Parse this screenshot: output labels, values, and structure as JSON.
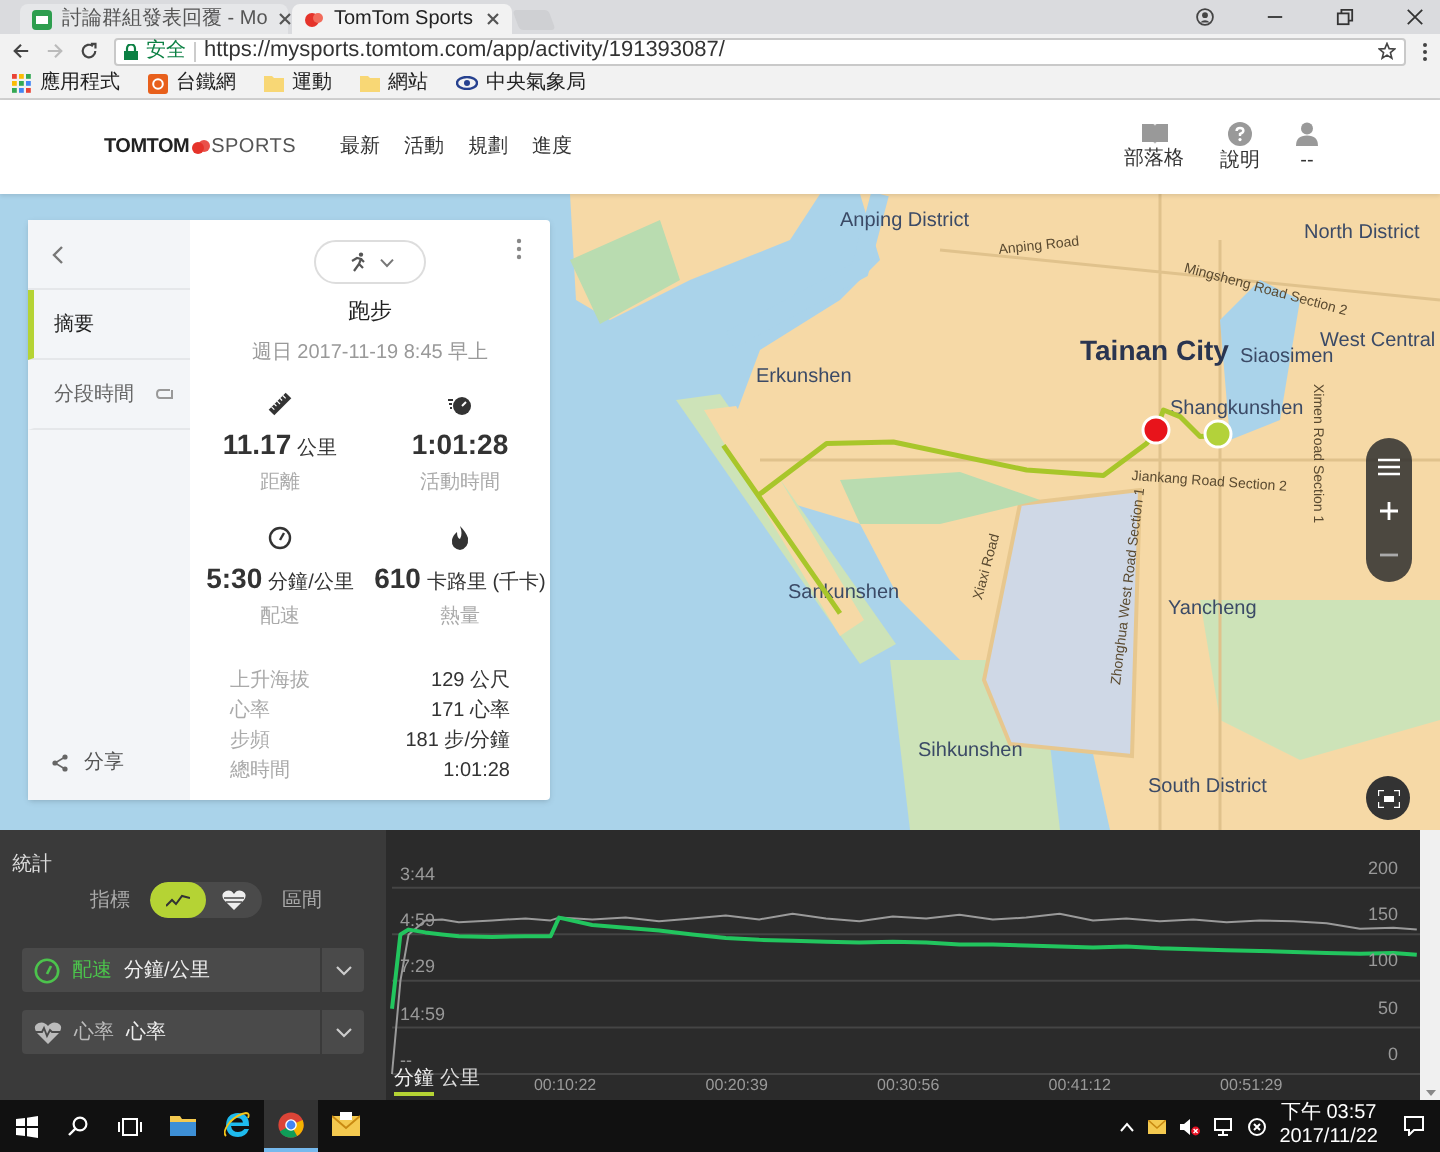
{
  "browser": {
    "tabs": [
      {
        "kind": "chat",
        "label": "討論群組發表回覆 - Mo",
        "selected": false
      },
      {
        "kind": "tomtom",
        "label": "TomTom Sports",
        "selected": true
      }
    ],
    "security": "安全",
    "url": "https://mysports.tomtom.com/app/activity/191393087/",
    "bookmarks": [
      {
        "kind": "apps",
        "label": "應用程式"
      },
      {
        "kind": "site",
        "label": "台鐵網"
      },
      {
        "kind": "folder",
        "label": "運動"
      },
      {
        "kind": "folder",
        "label": "網站"
      },
      {
        "kind": "eye",
        "label": "中央氣象局"
      }
    ]
  },
  "header": {
    "logo_main": "TOMTOM",
    "logo_sub": "SPORTS",
    "nav": [
      "最新",
      "活動",
      "規劃",
      "進度"
    ],
    "actions": [
      {
        "kind": "book",
        "label": "部落格"
      },
      {
        "kind": "help",
        "label": "說明"
      },
      {
        "kind": "user",
        "label": "--"
      }
    ]
  },
  "sidebar": {
    "items": [
      {
        "label": "摘要",
        "selected": true,
        "kind": "plain"
      },
      {
        "label": "分段時間",
        "selected": false,
        "kind": "laps"
      }
    ],
    "share": "分享"
  },
  "activity": {
    "title": "跑步",
    "date": "週日 2017-11-19 8:45 早上",
    "stats": [
      {
        "kind": "ruler",
        "value": "11.17",
        "unit": "公里",
        "label": "距離"
      },
      {
        "kind": "stopwatch",
        "value": "1:01:28",
        "label": "活動時間"
      },
      {
        "kind": "gauge",
        "value": "5:30",
        "unit": "分鐘/公里",
        "label": "配速"
      },
      {
        "kind": "flame",
        "value": "610",
        "unit": "卡路里 (千卡)",
        "label": "熱量"
      }
    ],
    "details": [
      {
        "label": "上升海拔",
        "value": "129 公尺"
      },
      {
        "label": "心率",
        "value": "171 心率"
      },
      {
        "label": "步頻",
        "value": "181 步/分鐘"
      },
      {
        "label": "總時間",
        "value": "1:01:28"
      }
    ]
  },
  "map": {
    "labels": [
      {
        "kind": "district",
        "text": "Anping District"
      },
      {
        "kind": "city",
        "text": "Tainan City"
      },
      {
        "kind": "district",
        "text": "Erkunshen"
      },
      {
        "kind": "district",
        "text": "Siaosimen"
      },
      {
        "kind": "district",
        "text": "Shangkunshen"
      },
      {
        "kind": "district",
        "text": "Sankunshen"
      },
      {
        "kind": "district",
        "text": "Yancheng"
      },
      {
        "kind": "district",
        "text": "Sihkunshen"
      },
      {
        "kind": "district",
        "text": "South District"
      },
      {
        "kind": "district",
        "text": "North District"
      },
      {
        "kind": "district",
        "text": "West Central"
      },
      {
        "kind": "road",
        "text": "Anping Road"
      },
      {
        "kind": "road",
        "text": "Jiankang Road Section 2"
      },
      {
        "kind": "road",
        "text": "Zhonghua West Road Section 1"
      },
      {
        "kind": "road",
        "text": "Mingsheng Road Section 2"
      },
      {
        "kind": "road",
        "text": "Ximen Road Section 1"
      },
      {
        "kind": "road",
        "text": "Xiaxi Road"
      }
    ]
  },
  "stats_panel": {
    "title": "統計",
    "toggle_left": "指標",
    "toggle_right": "區間",
    "views": [
      {
        "kind": "line",
        "selected": true
      },
      {
        "kind": "heart",
        "selected": false
      }
    ],
    "metrics": [
      {
        "kind": "pace",
        "name": "配速",
        "unit": "分鐘/公里",
        "active": true
      },
      {
        "kind": "heart",
        "name": "心率",
        "unit": "心率",
        "active": false
      }
    ],
    "units": [
      {
        "label": "分鐘",
        "selected": true
      },
      {
        "label": "公里",
        "selected": false
      }
    ],
    "pace_axis": [
      "3:44",
      "4:59",
      "7:29",
      "14:59",
      "--"
    ],
    "chart_data": {
      "type": "line",
      "x": [
        0,
        0.5,
        1,
        2,
        3,
        4,
        6,
        8,
        9.5,
        10,
        12,
        14,
        16,
        18,
        20,
        22,
        24,
        26,
        28,
        30,
        32,
        34,
        36,
        38,
        40,
        42,
        44,
        46,
        48,
        50,
        52,
        54,
        56,
        58,
        60,
        61.4
      ],
      "series": [
        {
          "color": "#9a9a9a",
          "values": [
            0,
            100,
            150,
            165,
            166,
            163,
            165,
            167,
            165,
            168,
            166,
            168,
            164,
            167,
            170,
            166,
            172,
            167,
            164,
            169,
            167,
            171,
            166,
            168,
            172,
            165,
            167,
            164,
            166,
            163,
            165,
            164,
            162,
            156,
            157,
            155
          ]
        },
        {
          "color": "#22c55e",
          "values": [
            70,
            150,
            155,
            152,
            150,
            148,
            147,
            148,
            148,
            168,
            160,
            157,
            154,
            150,
            146,
            144,
            143,
            142,
            141,
            142,
            141,
            139,
            139,
            138,
            137,
            136,
            137,
            135,
            134,
            133,
            132,
            131,
            130,
            129,
            130,
            128
          ]
        }
      ],
      "xlim": [
        0,
        61.47
      ],
      "ylim": [
        0,
        262
      ],
      "xticks": [
        {
          "value": 10.37,
          "label": "00:10:22"
        },
        {
          "value": 20.65,
          "label": "00:20:39"
        },
        {
          "value": 30.93,
          "label": "00:30:56"
        },
        {
          "value": 41.2,
          "label": "00:41:12"
        },
        {
          "value": 51.48,
          "label": "00:51:29"
        }
      ],
      "yticks": [
        0,
        50,
        100,
        150,
        200
      ],
      "grid": true
    }
  },
  "taskbar": {
    "apps": [
      {
        "kind": "folder",
        "active": false
      },
      {
        "kind": "ie",
        "active": false
      },
      {
        "kind": "chrome",
        "active": true
      },
      {
        "kind": "mail",
        "active": false
      }
    ],
    "time": "下午 03:57",
    "date": "2017/11/22"
  }
}
